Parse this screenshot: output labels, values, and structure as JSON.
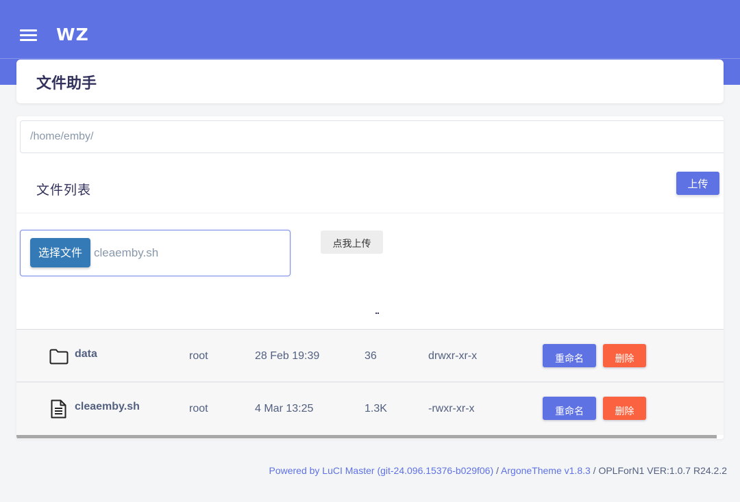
{
  "header": {
    "brand": "WZ",
    "menu_icon": "menu-icon"
  },
  "page": {
    "title": "文件助手"
  },
  "path": {
    "value": "/home/emby/"
  },
  "file_list": {
    "title": "文件列表",
    "upload_toggle_label": "上传",
    "choose_file_label": "选择文件",
    "chosen_file_name": "cleaemby.sh",
    "submit_label": "点我上传",
    "parent_dir": "..",
    "rows": [
      {
        "icon": "folder-icon",
        "name": "data",
        "owner": "root",
        "mtime": "28 Feb 19:39",
        "size": "36",
        "perms": "drwxr-xr-x",
        "rename": "重命名",
        "delete": "删除"
      },
      {
        "icon": "document-icon",
        "name": "cleaemby.sh",
        "owner": "root",
        "mtime": "4 Mar 13:25",
        "size": "1.3K",
        "perms": "-rwxr-xr-x",
        "rename": "重命名",
        "delete": "删除"
      }
    ]
  },
  "footer": {
    "luci_link": "Powered by LuCI Master (git-24.096.15376-b029f06)",
    "sep1": " / ",
    "theme_link": "ArgoneTheme v1.8.3",
    "sep2": " / ",
    "version": "OPLForN1 VER:1.0.7 R24.2.2"
  },
  "colors": {
    "primary": "#5e72e4",
    "danger": "#fb6340",
    "file_button": "#337ab7"
  }
}
